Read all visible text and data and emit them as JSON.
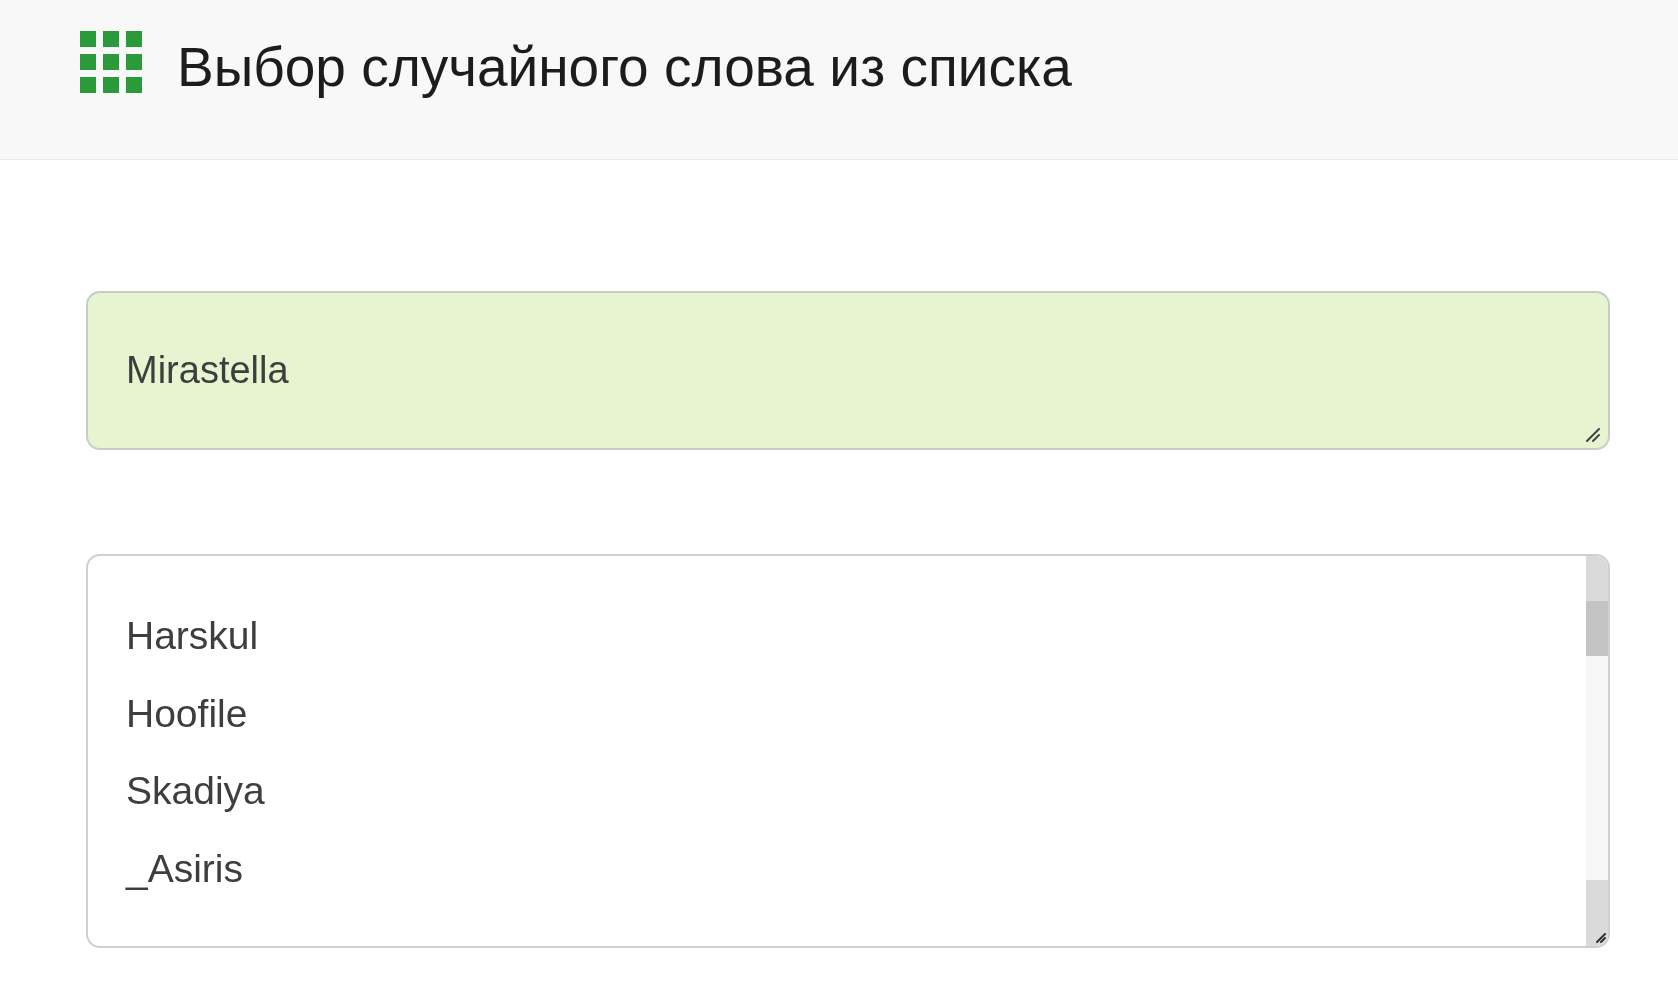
{
  "header": {
    "title": "Выбор случайного слова из списка"
  },
  "result_field": {
    "value": "Mirastella"
  },
  "word_list": {
    "lines": [
      "Harskul",
      "Hoofile",
      "Skadiya",
      "_Asiris"
    ]
  }
}
